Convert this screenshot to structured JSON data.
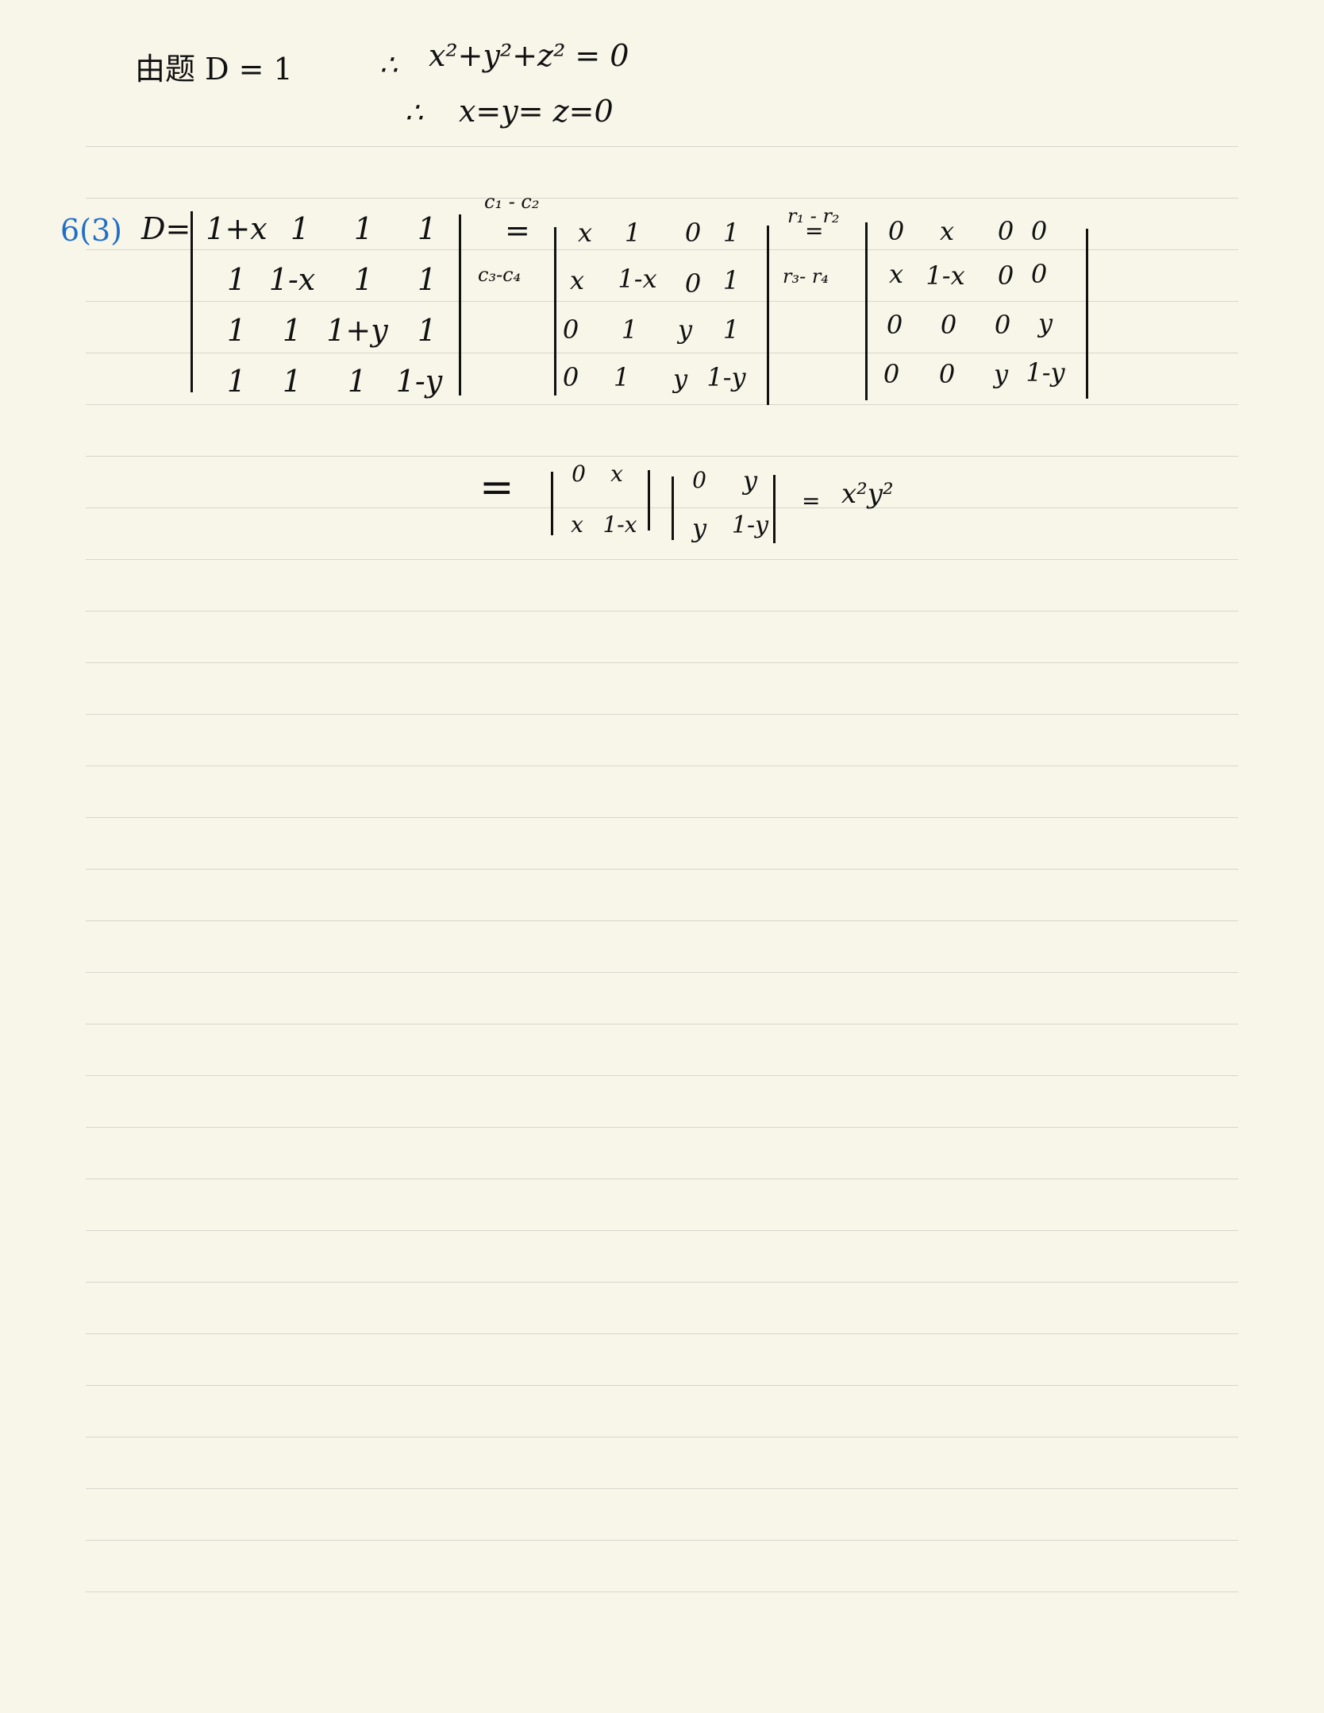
{
  "intro": {
    "left": "由题 D = 1",
    "therefore1": "∴",
    "eq1": "x²+y²+z² = 0",
    "therefore2": "∴",
    "eq2": "x=y= z=0"
  },
  "problem": {
    "number": "6(3)",
    "lhs": "D="
  },
  "matrix_a": [
    [
      "1+x",
      "1",
      "1",
      "1"
    ],
    [
      "1",
      "1-x",
      "1",
      "1"
    ],
    [
      "1",
      "1",
      "1+y",
      "1"
    ],
    [
      "1",
      "1",
      "1",
      "1-y"
    ]
  ],
  "op1": {
    "top": "c₁ - c₂",
    "eq": "=",
    "bottom": "c₃-c₄"
  },
  "matrix_b": [
    [
      "x",
      "1",
      "0",
      "1"
    ],
    [
      "x",
      "1-x",
      "0",
      "1"
    ],
    [
      "0",
      "1",
      "y",
      "1"
    ],
    [
      "0",
      "1",
      "y",
      "1-y"
    ]
  ],
  "op2": {
    "top": "r₁ - r₂",
    "eq": "=",
    "bottom": "r₃- r₄"
  },
  "matrix_c": [
    [
      "0",
      "x",
      "0",
      "0"
    ],
    [
      "x",
      "1-x",
      "0",
      "0"
    ],
    [
      "0",
      "0",
      "0",
      "y"
    ],
    [
      "0",
      "0",
      "y",
      "1-y"
    ]
  ],
  "result": {
    "eq": "=",
    "m1": [
      [
        "0",
        "x"
      ],
      [
        "x",
        "1-x"
      ]
    ],
    "m2": [
      [
        "0",
        "y"
      ],
      [
        "y",
        "1-y"
      ]
    ],
    "eq2": "=",
    "value": "x²y²"
  }
}
